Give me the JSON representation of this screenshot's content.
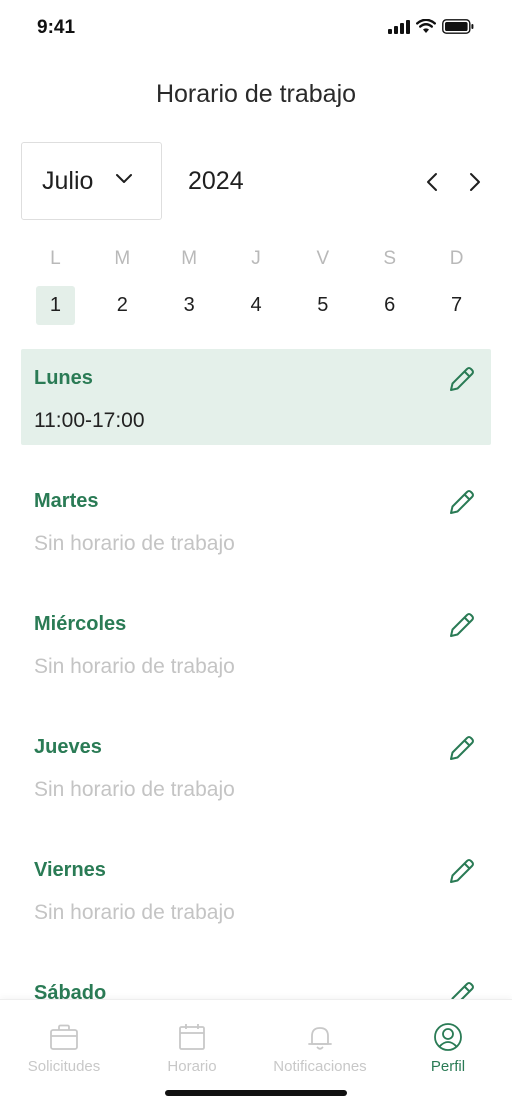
{
  "status_bar": {
    "time": "9:41"
  },
  "title": "Horario de trabajo",
  "calendar": {
    "month": "Julio",
    "year": "2024",
    "weekdays": [
      "L",
      "M",
      "M",
      "J",
      "V",
      "S",
      "D"
    ],
    "dates": [
      "1",
      "2",
      "3",
      "4",
      "5",
      "6",
      "7"
    ],
    "selected_date": "1"
  },
  "days": [
    {
      "name": "Lunes",
      "hours": "11:00-17:00"
    },
    {
      "name": "Martes",
      "hours": "Sin horario de trabajo"
    },
    {
      "name": "Miércoles",
      "hours": "Sin horario de trabajo"
    },
    {
      "name": "Jueves",
      "hours": "Sin horario de trabajo"
    },
    {
      "name": "Viernes",
      "hours": "Sin horario de trabajo"
    },
    {
      "name": "Sábado",
      "hours": ""
    }
  ],
  "tabbar": {
    "tabs": [
      {
        "label": "Solicitudes",
        "icon": "briefcase-icon"
      },
      {
        "label": "Horario",
        "icon": "calendar-icon"
      },
      {
        "label": "Notificaciones",
        "icon": "bell-icon"
      },
      {
        "label": "Perfil",
        "icon": "profile-icon"
      }
    ],
    "active": "Perfil"
  },
  "colors": {
    "accent": "#2a7b55",
    "active_bg": "#e4f0ea",
    "muted": "#c4c4c4"
  }
}
